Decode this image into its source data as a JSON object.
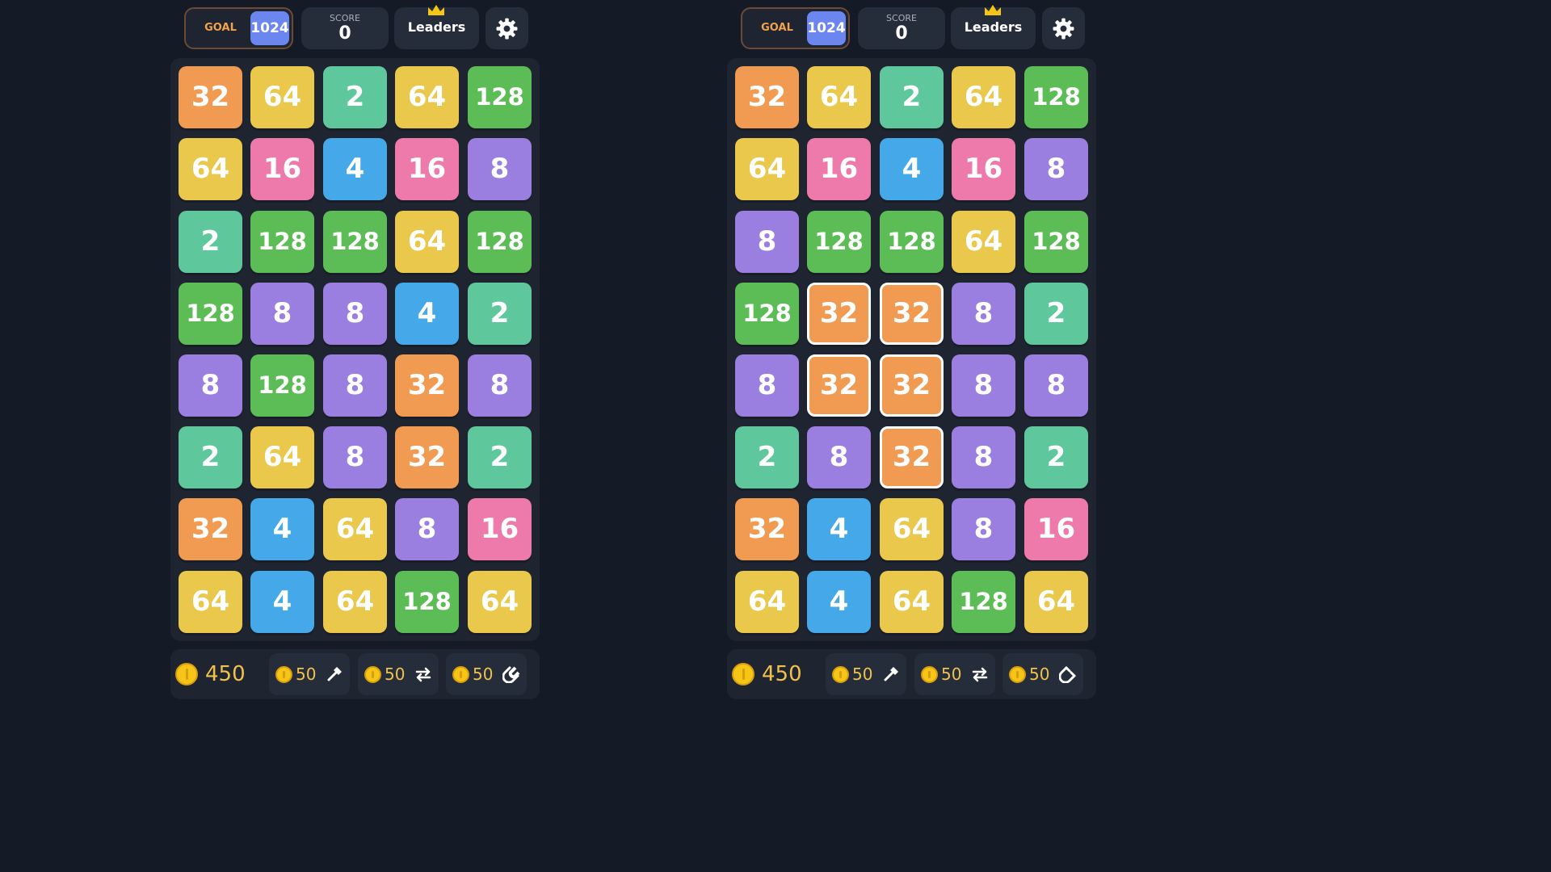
{
  "colors": {
    "background": "#151b26",
    "goal_accent": "#f0a24c",
    "goal_badge": "#6b86ee",
    "coin": "#f5c518",
    "selection_outline": "#ffffff",
    "tile_2": "#5ec89c",
    "tile_4": "#45a8e8",
    "tile_8": "#9b7fe0",
    "tile_16": "#ee7aab",
    "tile_32": "#f09a52",
    "tile_64": "#e9c84b",
    "tile_128": "#5cbd56"
  },
  "panels": [
    {
      "header": {
        "goal_label": "GOAL",
        "goal_value": "1024",
        "score_label": "SCORE",
        "score_value": "0",
        "leaders_label": "Leaders",
        "crown_icon": "crown-icon",
        "settings_icon": "gear-icon"
      },
      "board": [
        [
          "32",
          "64",
          "2",
          "64",
          "128"
        ],
        [
          "64",
          "16",
          "4",
          "16",
          "8"
        ],
        [
          "2",
          "128",
          "128",
          "64",
          "128"
        ],
        [
          "128",
          "8",
          "8",
          "4",
          "2"
        ],
        [
          "8",
          "128",
          "8",
          "32",
          "8"
        ],
        [
          "2",
          "64",
          "8",
          "32",
          "2"
        ],
        [
          "32",
          "4",
          "64",
          "8",
          "16"
        ],
        [
          "64",
          "4",
          "64",
          "128",
          "64"
        ]
      ],
      "selected_cells": [],
      "footer": {
        "coins": "450",
        "powerups": [
          {
            "cost": "50",
            "icon": "hammer-icon"
          },
          {
            "cost": "50",
            "icon": "swap-icon"
          },
          {
            "cost": "50",
            "icon": "magnet-icon"
          }
        ]
      }
    },
    {
      "header": {
        "goal_label": "GOAL",
        "goal_value": "1024",
        "score_label": "SCORE",
        "score_value": "0",
        "leaders_label": "Leaders",
        "crown_icon": "crown-icon",
        "settings_icon": "gear-icon"
      },
      "board": [
        [
          "32",
          "64",
          "2",
          "64",
          "128"
        ],
        [
          "64",
          "16",
          "4",
          "16",
          "8"
        ],
        [
          "8",
          "128",
          "128",
          "64",
          "128"
        ],
        [
          "128",
          "32",
          "32",
          "8",
          "2"
        ],
        [
          "8",
          "32",
          "32",
          "8",
          "8"
        ],
        [
          "2",
          "8",
          "32",
          "8",
          "2"
        ],
        [
          "32",
          "4",
          "64",
          "8",
          "16"
        ],
        [
          "64",
          "4",
          "64",
          "128",
          "64"
        ]
      ],
      "selected_cells": [
        [
          3,
          1
        ],
        [
          3,
          2
        ],
        [
          4,
          1
        ],
        [
          4,
          2
        ],
        [
          5,
          2
        ]
      ],
      "footer": {
        "coins": "450",
        "powerups": [
          {
            "cost": "50",
            "icon": "hammer-icon"
          },
          {
            "cost": "50",
            "icon": "swap-icon"
          },
          {
            "cost": "50",
            "icon": "magnet-icon"
          }
        ]
      }
    }
  ]
}
